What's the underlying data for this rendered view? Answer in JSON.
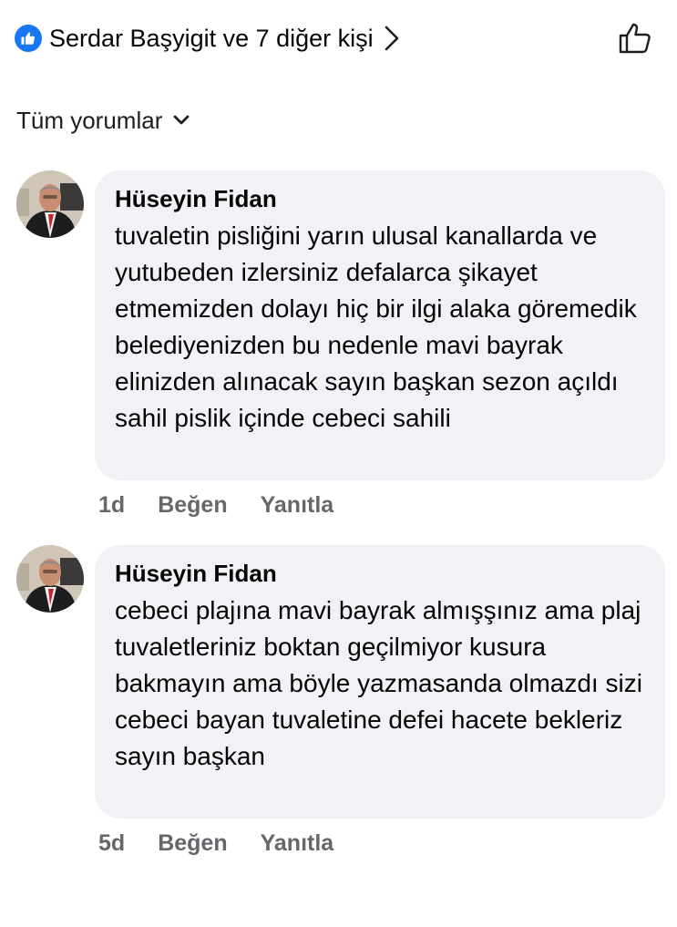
{
  "reactions": {
    "text": "Serdar Başyigit ve 7 diğer kişi"
  },
  "sort": {
    "label": "Tüm yorumlar"
  },
  "comments": [
    {
      "author": "Hüseyin Fidan",
      "text": "tuvaletin pisliğini yarın ulusal kanallarda ve yutubeden izlersiniz defalarca şikayet etmemizden dolayı hiç bir ilgi alaka göremedik belediyenizden bu nedenle mavi bayrak elinizden alınacak sayın başkan sezon açıldı sahil pislik içinde cebeci sahili",
      "time": "1d",
      "like_label": "Beğen",
      "reply_label": "Yanıtla"
    },
    {
      "author": "Hüseyin Fidan",
      "text": "cebeci plajına mavi bayrak almışşınız ama plaj tuvaletleriniz boktan geçilmiyor kusura bakmayın ama böyle yazmasanda olmazdı sizi cebeci bayan tuvaletine defei hacete bekleriz sayın başkan",
      "time": "5d",
      "like_label": "Beğen",
      "reply_label": "Yanıtla"
    }
  ],
  "colors": {
    "accent": "#1877f2",
    "bubble": "#f0f2f5",
    "meta": "#65676b"
  }
}
